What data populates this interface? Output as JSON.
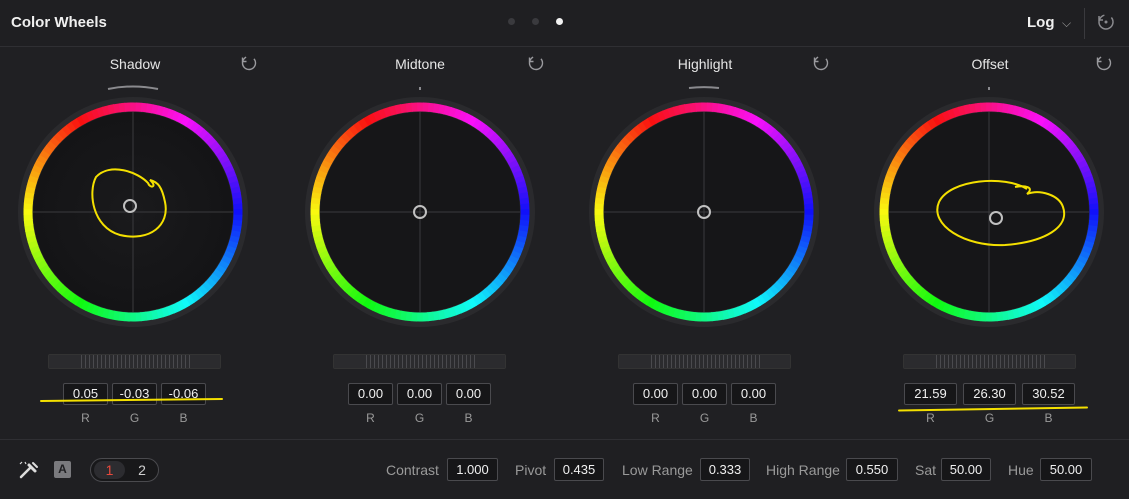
{
  "header": {
    "title": "Color Wheels",
    "mode": "Log"
  },
  "wheels": [
    {
      "label": "Shadow",
      "values": [
        "0.05",
        "-0.03",
        "-0.06"
      ]
    },
    {
      "label": "Midtone",
      "values": [
        "0.00",
        "0.00",
        "0.00"
      ]
    },
    {
      "label": "Highlight",
      "values": [
        "0.00",
        "0.00",
        "0.00"
      ]
    },
    {
      "label": "Offset",
      "values": [
        "21.59",
        "26.30",
        "30.52"
      ]
    }
  ],
  "channel_labels": [
    "R",
    "G",
    "B"
  ],
  "footer": {
    "toggle_a": "A",
    "seg1": "1",
    "seg2": "2",
    "contrast_label": "Contrast",
    "contrast": "1.000",
    "pivot_label": "Pivot",
    "pivot": "0.435",
    "low_range_label": "Low Range",
    "low_range": "0.333",
    "high_range_label": "High Range",
    "high_range": "0.550",
    "sat_label": "Sat",
    "sat": "50.00",
    "hue_label": "Hue",
    "hue": "50.00"
  },
  "colors": {
    "annotation": "#f4e000",
    "accent_red": "#e8493c"
  }
}
